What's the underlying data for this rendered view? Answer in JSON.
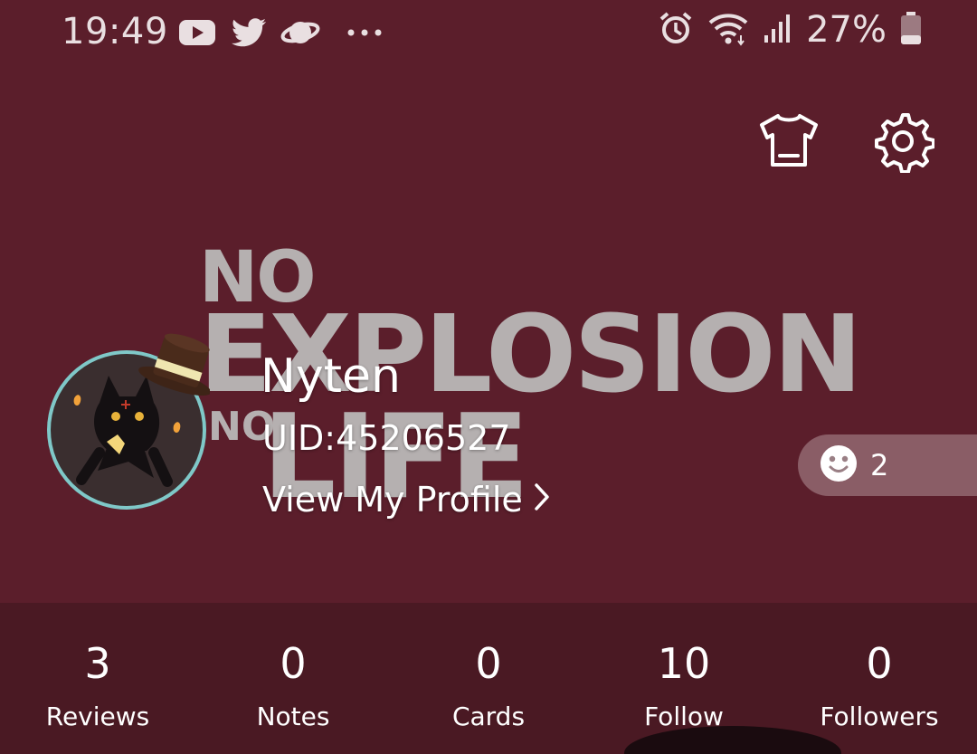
{
  "status_bar": {
    "time": "19:49",
    "left_icons": [
      "youtube-icon",
      "twitter-icon",
      "planet-icon",
      "more-notifications-icon"
    ],
    "right_icons": [
      "alarm-icon",
      "wifi-icon",
      "signal-icon",
      "battery-icon"
    ],
    "battery": "27%"
  },
  "header": {
    "actions": [
      "tshirt-icon",
      "settings-gear-icon"
    ]
  },
  "background": {
    "line1": "NO",
    "line2": "EXPLOSION",
    "line3": "NO",
    "line4": "LIFE"
  },
  "profile": {
    "name": "Nyten",
    "uid": "UID:45206527",
    "view_profile": "View My Profile"
  },
  "reaction": {
    "icon": "smiley-face-icon",
    "count": "2"
  },
  "stats": [
    {
      "value": "3",
      "label": "Reviews"
    },
    {
      "value": "0",
      "label": "Notes"
    },
    {
      "value": "0",
      "label": "Cards"
    },
    {
      "value": "10",
      "label": "Follow"
    },
    {
      "value": "0",
      "label": "Followers"
    }
  ],
  "colors": {
    "background": "#5b1e2b",
    "stats_background": "#4a1923",
    "avatar_ring": "#7fc8c8"
  }
}
